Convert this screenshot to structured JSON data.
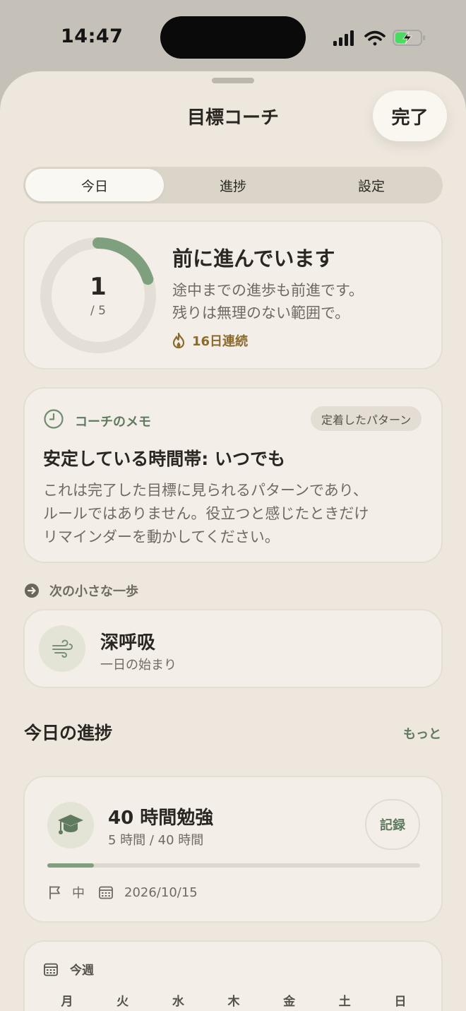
{
  "status_bar": {
    "time": "14:47"
  },
  "header": {
    "title": "目標コーチ",
    "done_label": "完了"
  },
  "tabs": [
    {
      "label": "今日",
      "active": true
    },
    {
      "label": "進捗",
      "active": false
    },
    {
      "label": "設定",
      "active": false
    }
  ],
  "progress": {
    "completed": "1",
    "total_label": "/ 5",
    "completed_value": 1,
    "total_value": 5,
    "headline": "前に進んでいます",
    "line1": "途中までの進歩も前進です。",
    "line2": "残りは無理のない範囲で。",
    "streak": "16日連続"
  },
  "memo": {
    "label": "コーチのメモ",
    "badge": "定着したパターン",
    "headline": "安定している時間帯: いつでも",
    "body1": "これは完了した目標に見られるパターンであり、",
    "body2": "ルールではありません。役立つと感じたときだけ",
    "body3": "リマインダーを動かしてください。"
  },
  "next_step": {
    "label": "次の小さな一歩",
    "title": "深呼吸",
    "subtitle": "一日の始まり"
  },
  "today_progress": {
    "title": "今日の進捗",
    "more_label": "もっと",
    "goal": {
      "title": "40 時間勉強",
      "subtitle": "5 時間 / 40 時間",
      "progress_fraction": 0.125,
      "record_label": "記録",
      "priority": "中",
      "due_date": "2026/10/15"
    }
  },
  "week": {
    "label": "今週",
    "days": [
      "月",
      "火",
      "水",
      "木",
      "金",
      "土",
      "日"
    ]
  },
  "colors": {
    "accent_green": "#7fa07f",
    "streak_brown": "#8b6a2d",
    "background": "#ede7dd",
    "card": "#f3efe8"
  },
  "icons": {
    "memo": "clock-icon",
    "streak": "flame-icon",
    "next_step": "arrow-right-circle-icon",
    "breath": "wind-icon",
    "goal": "graduation-cap-icon",
    "priority": "flag-icon",
    "due": "calendar-icon",
    "week": "calendar-icon"
  }
}
